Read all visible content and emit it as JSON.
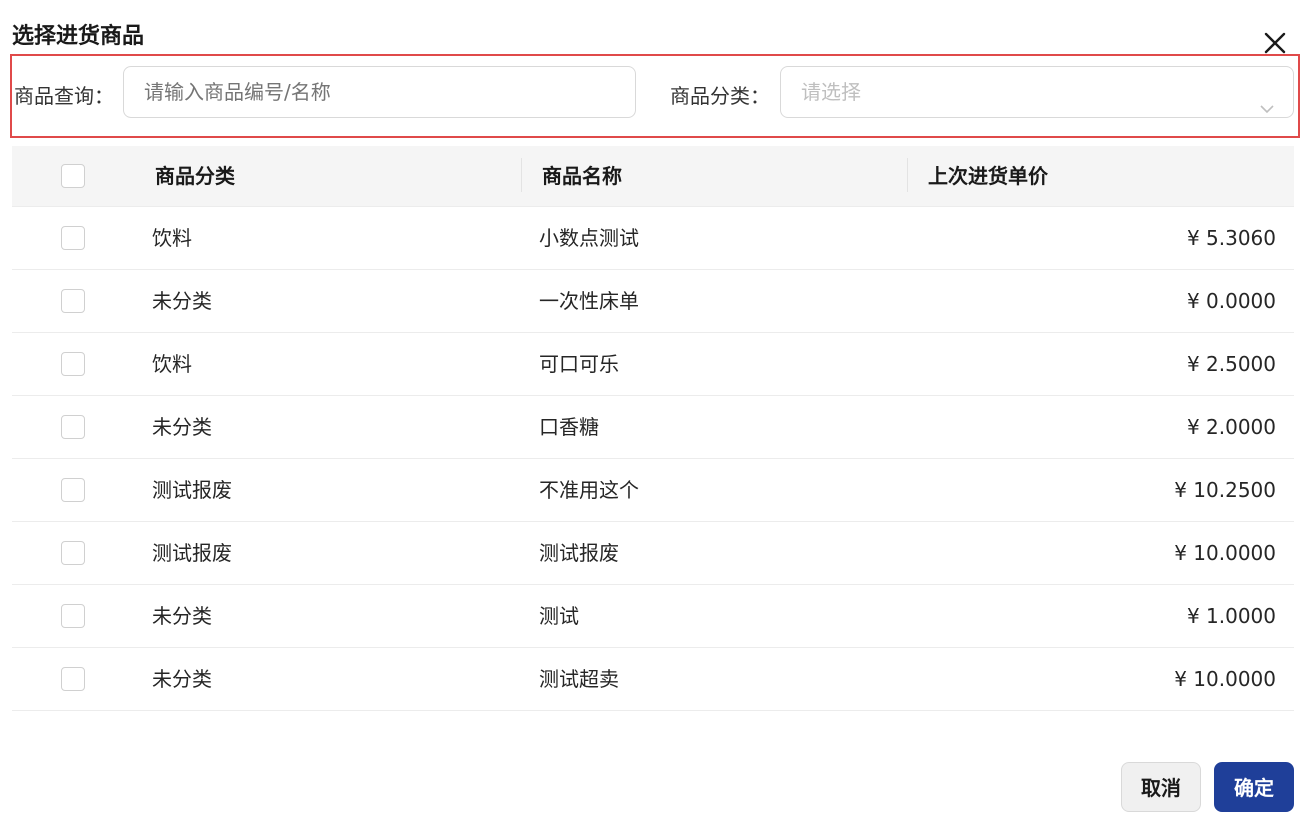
{
  "dialog": {
    "title": "选择进货商品"
  },
  "filters": {
    "search_label": "商品查询：",
    "search_placeholder": "请输入商品编号/名称",
    "category_label": "商品分类：",
    "category_placeholder": "请选择"
  },
  "table": {
    "headers": [
      "商品分类",
      "商品名称",
      "上次进货单价"
    ],
    "rows": [
      {
        "category": "饮料",
        "name": "小数点测试",
        "price": "¥ 5.3060"
      },
      {
        "category": "未分类",
        "name": "一次性床单",
        "price": "¥ 0.0000"
      },
      {
        "category": "饮料",
        "name": "可口可乐",
        "price": "¥ 2.5000"
      },
      {
        "category": "未分类",
        "name": "口香糖",
        "price": "¥ 2.0000"
      },
      {
        "category": "测试报废",
        "name": "不准用这个",
        "price": "¥ 10.2500"
      },
      {
        "category": "测试报废",
        "name": "测试报废",
        "price": "¥ 10.0000"
      },
      {
        "category": "未分类",
        "name": "测试",
        "price": "¥ 1.0000"
      },
      {
        "category": "未分类",
        "name": "测试超卖",
        "price": "¥ 10.0000"
      }
    ]
  },
  "footer": {
    "cancel_label": "取消",
    "confirm_label": "确定"
  },
  "colors": {
    "highlight_border": "#e04a4a",
    "primary": "#1f3f99"
  },
  "icons": {
    "close": "close-icon",
    "dropdown": "chevron-down-icon"
  }
}
